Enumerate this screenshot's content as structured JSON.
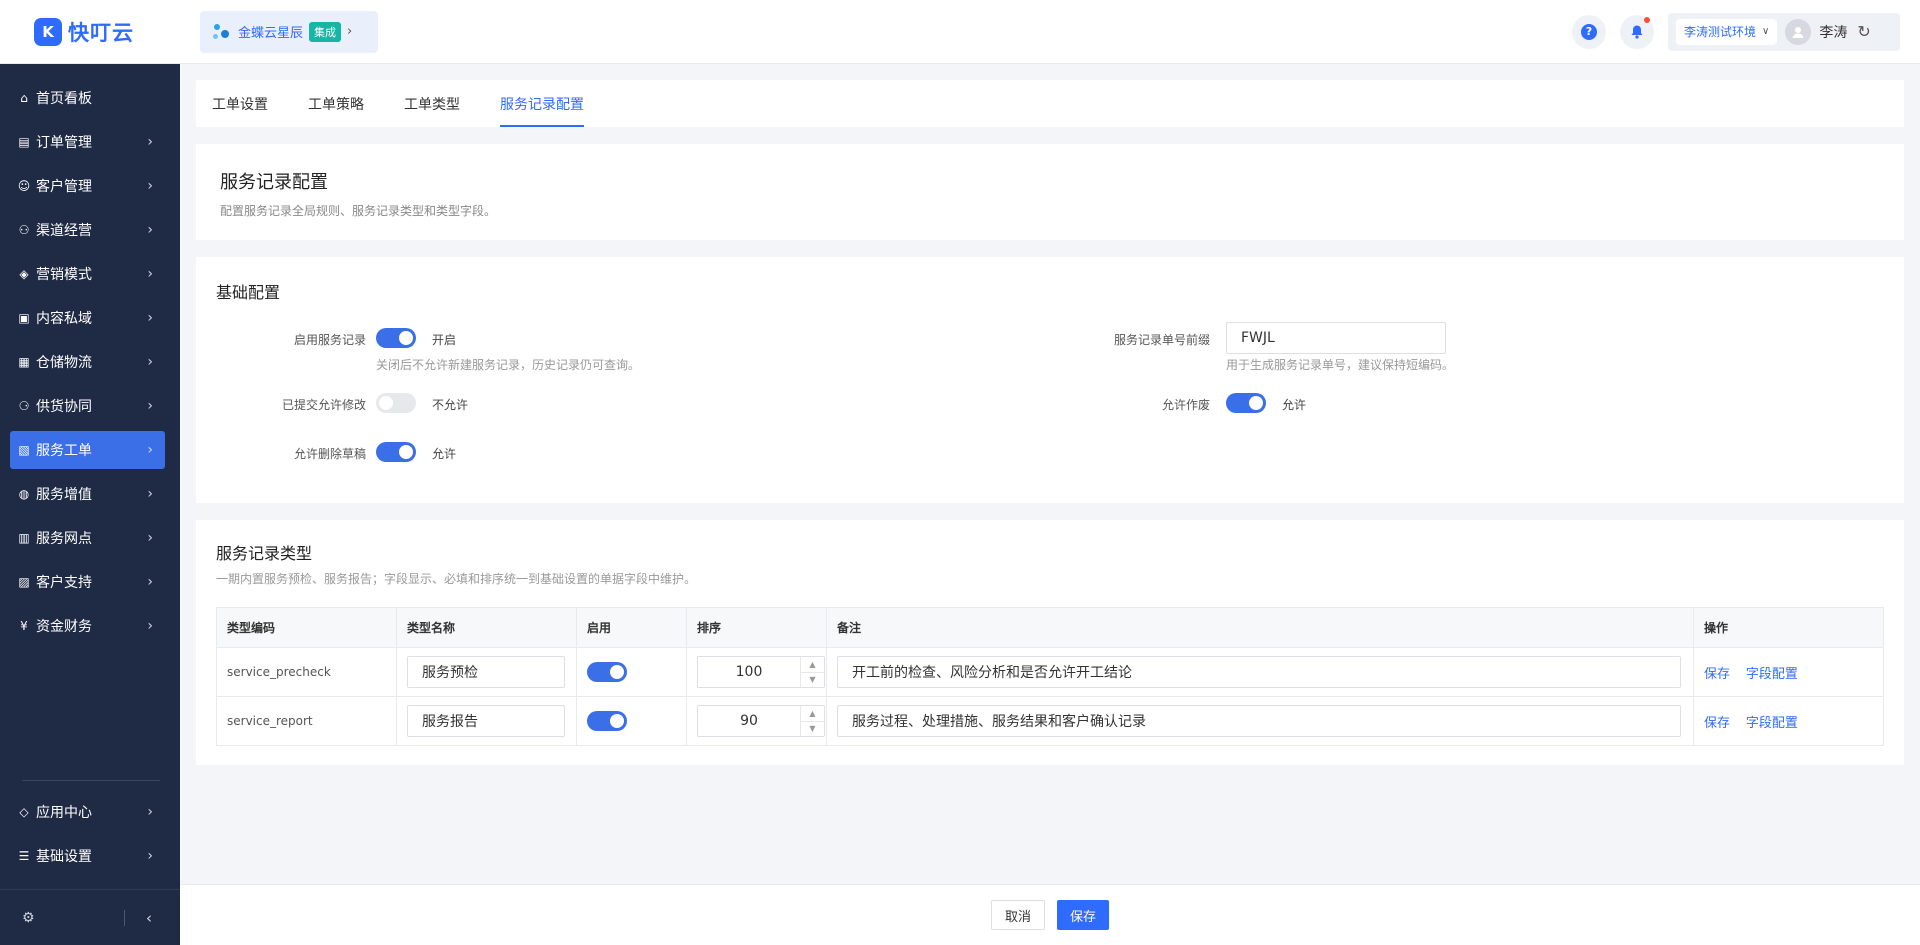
{
  "app": {
    "logo_mark": "K",
    "logo_text": "快叮云"
  },
  "integration": {
    "name": "金蝶云星辰",
    "badge": "集成"
  },
  "header": {
    "help_icon": "?",
    "environment": "李涛测试环境",
    "user_name": "李涛"
  },
  "sidebar": {
    "items": [
      {
        "label": "首页看板",
        "icon": "home-icon",
        "glyph": "⌂"
      },
      {
        "label": "订单管理",
        "icon": "order-icon",
        "glyph": "▤"
      },
      {
        "label": "客户管理",
        "icon": "user-icon",
        "glyph": "☺"
      },
      {
        "label": "渠道经营",
        "icon": "channel-icon",
        "glyph": "⚇"
      },
      {
        "label": "营销模式",
        "icon": "tag-icon",
        "glyph": "◈"
      },
      {
        "label": "内容私域",
        "icon": "image-icon",
        "glyph": "▣"
      },
      {
        "label": "仓储物流",
        "icon": "warehouse-icon",
        "glyph": "▦"
      },
      {
        "label": "供货协同",
        "icon": "supply-icon",
        "glyph": "⚆"
      },
      {
        "label": "服务工单",
        "icon": "ticket-icon",
        "glyph": "▧"
      },
      {
        "label": "服务增值",
        "icon": "bag-icon",
        "glyph": "◍"
      },
      {
        "label": "服务网点",
        "icon": "store-icon",
        "glyph": "▥"
      },
      {
        "label": "客户支持",
        "icon": "support-icon",
        "glyph": "▨"
      },
      {
        "label": "资金财务",
        "icon": "finance-icon",
        "glyph": "¥"
      }
    ],
    "bottom_items": [
      {
        "label": "应用中心",
        "icon": "app-icon",
        "glyph": "◇"
      },
      {
        "label": "基础设置",
        "icon": "settings-icon",
        "glyph": "☰"
      }
    ],
    "active_index": 8
  },
  "tabs": [
    "工单设置",
    "工单策略",
    "工单类型",
    "服务记录配置"
  ],
  "active_tab": 3,
  "page": {
    "title": "服务记录配置",
    "description": "配置服务记录全局规则、服务记录类型和类型字段。"
  },
  "basic_config": {
    "title": "基础配置",
    "enable_record": {
      "label": "启用服务记录",
      "state": "开启",
      "on": true,
      "help": "关闭后不允许新建服务记录，历史记录仍可查询。"
    },
    "allow_edit": {
      "label": "已提交允许修改",
      "state": "不允许",
      "on": false
    },
    "allow_delete": {
      "label": "允许删除草稿",
      "state": "允许",
      "on": true
    },
    "prefix": {
      "label": "服务记录单号前缀",
      "value": "FWJL",
      "help": "用于生成服务记录单号，建议保持短编码。"
    },
    "allow_void": {
      "label": "允许作废",
      "state": "允许",
      "on": true
    }
  },
  "record_types": {
    "title": "服务记录类型",
    "description": "一期内置服务预检、服务报告；字段显示、必填和排序统一到基础设置的单据字段中维护。",
    "columns": [
      "类型编码",
      "类型名称",
      "启用",
      "排序",
      "备注",
      "操作"
    ],
    "rows": [
      {
        "code": "service_precheck",
        "name": "服务预检",
        "enabled": true,
        "order": "100",
        "note": "开工前的检查、风险分析和是否允许开工结论",
        "op_save": "保存",
        "op_fields": "字段配置"
      },
      {
        "code": "service_report",
        "name": "服务报告",
        "enabled": true,
        "order": "90",
        "note": "服务过程、处理措施、服务结果和客户确认记录",
        "op_save": "保存",
        "op_fields": "字段配置"
      }
    ]
  },
  "footer": {
    "cancel": "取消",
    "save": "保存"
  }
}
